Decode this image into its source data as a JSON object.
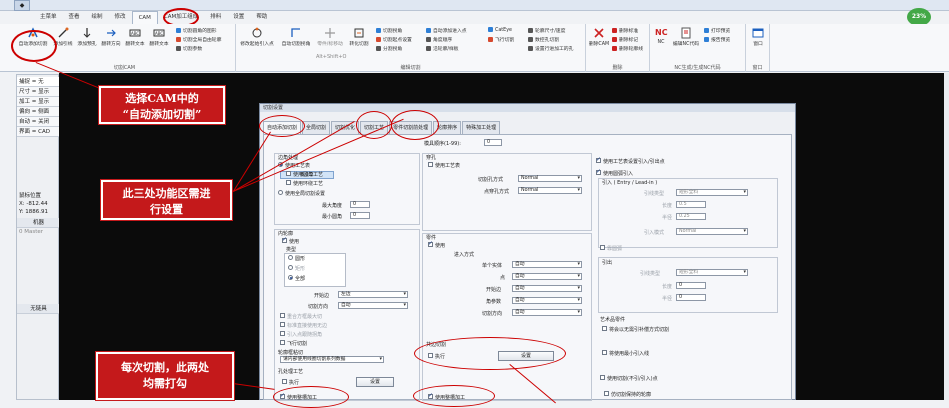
{
  "menu": {
    "tabs": [
      "主菜单",
      "查看",
      "绘制",
      "修改",
      "CAM",
      "CAM加工组成",
      "排料",
      "设置",
      "帮助"
    ],
    "active": "CAM"
  },
  "ribbon": {
    "cam_group": {
      "label": "切割CAM",
      "buttons": [
        "自动添加切割",
        "添加引线",
        "添加预孔",
        "翻转方向",
        "翻转文本",
        "翻转文本"
      ],
      "small": [
        "切割圆角的图形",
        "切割全局自由轮廓",
        "切割参数"
      ]
    },
    "lead_group": {
      "label": "编辑切割",
      "buttons": [
        "修改起始引入点",
        "自动切割拐角",
        "零件/标移动",
        "转化切割"
      ],
      "small": [
        "切割拐角",
        "切割起点设置",
        "分割拐角",
        "自动添加进入点",
        "角度顺序",
        "沿轮廓/样板",
        "CatEye",
        "飞行切割",
        "轮廓尺寸/速度",
        "数控孔切割",
        "设置行进加工的孔"
      ],
      "alt_hint": "Alt+Shift+O"
    },
    "delete_group": {
      "label": "删除",
      "buttons": [
        "删除CAM",
        "删除标准",
        "删除标记",
        "删除轮廓线"
      ]
    },
    "nc_group": {
      "label": "NC生成/生成NC代码",
      "buttons": [
        "NC",
        "编辑NC代码",
        "打印预览",
        "报告预览"
      ]
    },
    "window_group": {
      "label": "窗口",
      "buttons": [
        "窗口"
      ]
    }
  },
  "zoom_badge": "23%",
  "left_panel": {
    "items": [
      "捕捉 = 无",
      "尺寸 = 显示",
      "加工 = 显示",
      "偏向 = 侧面",
      "自动 = 关闭",
      "界面 = CAD"
    ],
    "mouse_label": "鼠标位置",
    "x_label": "X:",
    "x_value": "-812.44",
    "y_label": "Y:",
    "y_value": "1886.91",
    "machine_label": "机器",
    "machine_value": "0 Master",
    "tool_button": "无链具"
  },
  "dialog": {
    "title": "切割设置",
    "tabs": [
      "自动添加切割",
      "全局切割",
      "切割优化",
      "切割工艺",
      "零件切割前处理",
      "轮廓排序",
      "特殊加工处理"
    ],
    "active_tab": "自动添加切割",
    "version": "8.0.2",
    "left": {
      "corner_title": "边角处理",
      "use_process": "使用工艺表",
      "use_round": "使用圆角工艺",
      "use_loop": "使用环绕工艺",
      "use_global": "使用全局切割设置",
      "max_angle_label": "最大角度",
      "max_angle": "0",
      "min_angle_label": "最小圆角",
      "min_angle": "0",
      "inner_title": "内轮廓",
      "use": "使用",
      "type_label": "类型",
      "type_options": [
        "圆形",
        "矩形",
        "全部"
      ],
      "start_label": "开始边",
      "start_value": "左边",
      "dir_label": "切割方向",
      "dir_value": "自动",
      "checks": [
        "重合方框最大切",
        "标准直接使用无边",
        "引入点跟随拐角",
        "飞行切割"
      ],
      "rule_label": "轮廓框粘切",
      "rule_value": "请内部使用线圈切割系列数据",
      "small_hole": "孔处理工艺",
      "exec": "执行",
      "set_btn": "设置",
      "last_check": "使用整槽加工"
    },
    "middle": {
      "lead_order_label": "模具顺序(1-99):",
      "lead_order": "0",
      "hole_title": "穿孔",
      "hole_use": "使用工艺表",
      "hole_type_label": "切割孔方式",
      "hole_type_value": "Normal",
      "point_type_label": "点穿孔方式",
      "point_type_value": "Normal",
      "part_title": "零件",
      "part_use": "使用",
      "entry_label": "进入方式",
      "rows": [
        {
          "label": "单个实体",
          "value": "自动"
        },
        {
          "label": "点",
          "value": "自动"
        },
        {
          "label": "开始边",
          "value": "自动"
        },
        {
          "label": "角参数",
          "value": "自动"
        },
        {
          "label": "切割方向",
          "value": "自动"
        }
      ],
      "common_title": "共边切割",
      "common_exec": "执行",
      "common_btn": "设置",
      "last_check": "使用整槽加工"
    },
    "right": {
      "use_process": "使用工艺表设置引入/引出点",
      "use_round": "使用圆弧引入",
      "lead_in_title": "引入 ( Entry / Lead-in )",
      "lead_type_label": "引线类型",
      "lead_type_value": "短形全料",
      "length_label": "长度",
      "length_value": "0.5",
      "radius_label": "半径",
      "radius_value": "0.25",
      "lead_mode_label": "引入模式",
      "lead_mode_value": "Normal",
      "mid_check": "靠圆弧",
      "lead_out_title": "引出",
      "out_type_label": "引线类型",
      "out_type_value": "短形全料",
      "out_len_label": "长度",
      "out_len_value": "0",
      "out_r_label": "半径",
      "out_r_value": "0",
      "art_title": "艺术品零件",
      "art_check": "将会以无需引补偿方式切割",
      "use_nc": "将使用最小引入线",
      "bottom1": "使用切割(不引/引入)点",
      "bottom2": "仿切割保持的轮廓"
    }
  },
  "annotations": {
    "a1": "选择CAM中的\n“自动添加切割”",
    "a2": "此三处功能区需进\n行设置",
    "a3": "每次切割，此两处\n均需打勾"
  }
}
